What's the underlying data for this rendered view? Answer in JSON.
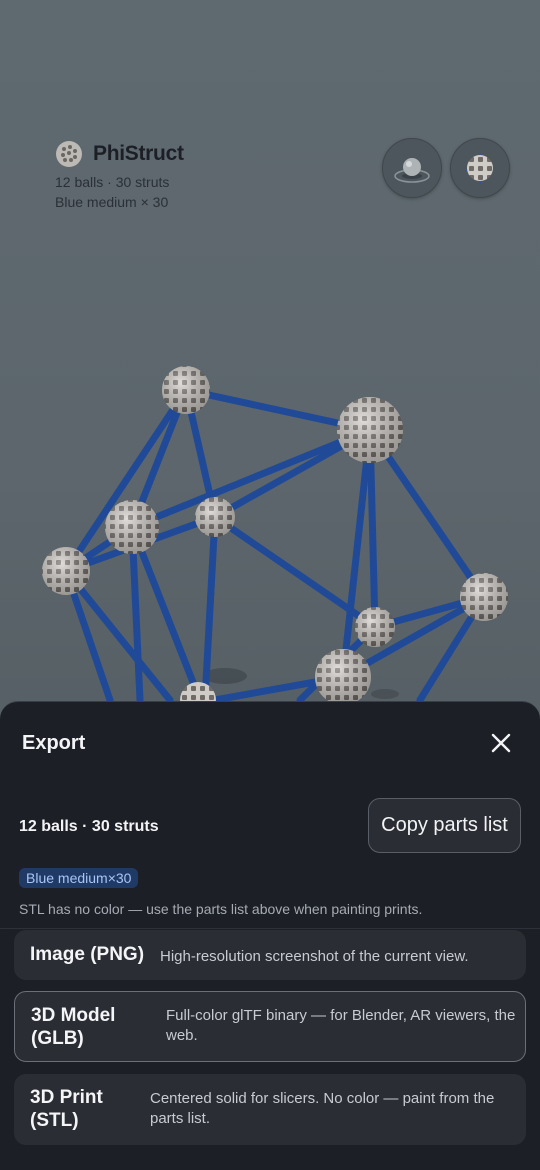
{
  "app": {
    "title": "PhiStruct",
    "stats": "12 balls · 30 struts",
    "color_summary": "Blue medium × 30"
  },
  "toolbar": {
    "view_icon": "sphere-view-icon",
    "model_icon": "wireframe-model-icon"
  },
  "export": {
    "title": "Export",
    "close_icon": "close-icon",
    "summary": "12 balls · 30 struts",
    "copy_label": "Copy parts list",
    "chip": "Blue medium×30",
    "note": "STL has no color — use the parts list above when painting prints.",
    "options": [
      {
        "name": "Image (PNG)",
        "description": "High-resolution screenshot of the current view."
      },
      {
        "name": "3D Model (GLB)",
        "description": "Full-color glTF binary — for Blender, AR viewers, the web.",
        "selected": true
      },
      {
        "name": "3D Print (STL)",
        "description": "Centered solid for slicers. No color — paint from the parts list."
      }
    ]
  },
  "colors": {
    "strut": "#1f4a99",
    "ball": "#c9c6c2",
    "sheet_bg": "#1c1f25",
    "chip_bg": "#203a66",
    "chip_text": "#a9c4f5"
  }
}
